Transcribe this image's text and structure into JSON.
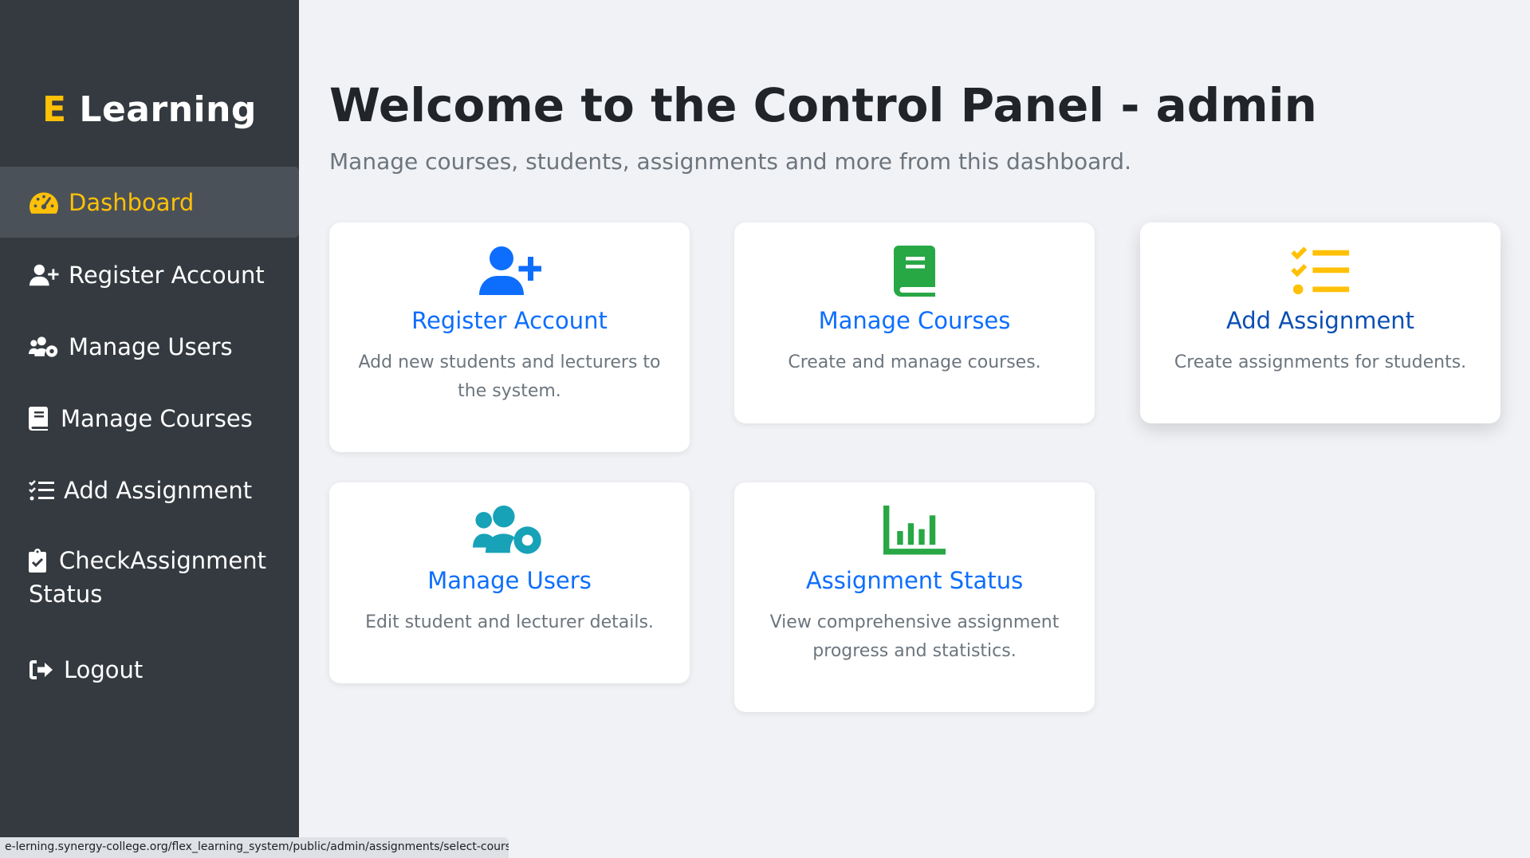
{
  "brand": {
    "prefix": "E",
    "name": " Learning"
  },
  "colors": {
    "accent": "#ffc107",
    "sidebar": "#343a40",
    "primary": "#0d6efd",
    "success": "#28a745",
    "info": "#17a2b8"
  },
  "sidebar": {
    "items": [
      {
        "label": "Dashboard",
        "icon": "gauge-icon",
        "active": true
      },
      {
        "label": "Register Account",
        "icon": "user-plus-icon"
      },
      {
        "label": "Manage Users",
        "icon": "users-cog-icon"
      },
      {
        "label": "Manage Courses",
        "icon": "book-icon"
      },
      {
        "label": "Add Assignment",
        "icon": "list-check-icon"
      },
      {
        "label_line1": "CheckAssignment",
        "label_line2": "Status",
        "icon": "clipboard-check-icon"
      },
      {
        "label": "Logout",
        "icon": "sign-out-icon"
      }
    ]
  },
  "main": {
    "title": "Welcome to the Control Panel - admin",
    "subtitle": "Manage courses, students, assignments and more from this dashboard."
  },
  "cards": [
    {
      "title": "Register Account",
      "desc": "Add new students and lecturers to the system.",
      "icon": "user-plus-icon",
      "color": "#0d6efd"
    },
    {
      "title": "Manage Courses",
      "desc": "Create and manage courses.",
      "icon": "book-icon",
      "color": "#28a745"
    },
    {
      "title": "Add Assignment",
      "desc": "Create assignments for students.",
      "icon": "list-check-icon",
      "color": "#ffc107"
    },
    {
      "title": "Manage Users",
      "desc": "Edit student and lecturer details.",
      "icon": "users-cog-icon",
      "color": "#17a2b8"
    },
    {
      "title": "Assignment Status",
      "desc": "View comprehensive assignment progress and statistics.",
      "icon": "chart-bar-icon",
      "color": "#28a745"
    }
  ],
  "status_bar": {
    "url": "e-lerning.synergy-college.org/flex_learning_system/public/admin/assignments/select-course"
  }
}
